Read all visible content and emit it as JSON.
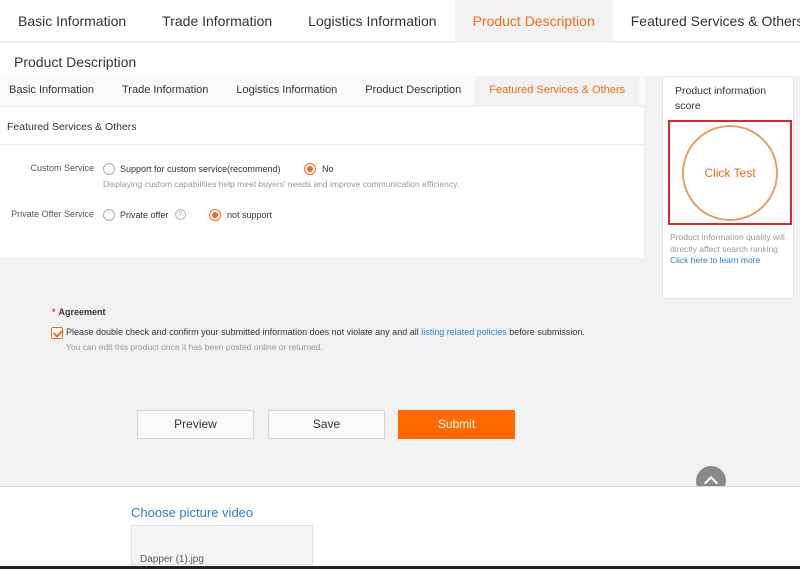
{
  "top_tabs": [
    {
      "label": "Basic Information"
    },
    {
      "label": "Trade Information"
    },
    {
      "label": "Logistics Information"
    },
    {
      "label": "Product Description"
    },
    {
      "label": "Featured Services & Others"
    }
  ],
  "page_title": "Product Description",
  "sub_tabs": [
    {
      "label": "Basic Information"
    },
    {
      "label": "Trade Information"
    },
    {
      "label": "Logistics Information"
    },
    {
      "label": "Product Description"
    },
    {
      "label": "Featured Services & Others"
    }
  ],
  "section_title": "Featured Services & Others",
  "custom_service": {
    "label": "Custom Service",
    "option_support": "Support for custom service(recommend)",
    "option_no": "No",
    "selected": "No",
    "hint": "Displaying custom capabilities help meet buyers' needs and improve communication efficiency."
  },
  "private_offer": {
    "label": "Private Offer Service",
    "option_private": "Private offer",
    "option_not_support": "not support",
    "selected": "not support"
  },
  "score_panel": {
    "title": "Product information score",
    "button": "Click Test",
    "note": "Product information quality will directly affect search ranking",
    "link": "Click here to learn more"
  },
  "agreement": {
    "label": "Agreement",
    "text_before": "Please double check and confirm your submitted information does not violate any and all",
    "link": "listing related policies",
    "text_after": "before submission.",
    "sub": "You can edit this product once it has been posted online or returned.",
    "checked": true
  },
  "buttons": {
    "preview": "Preview",
    "save": "Save",
    "submit": "Submit"
  },
  "media": {
    "title": "Choose picture video",
    "filename": "Dapper (1).jpg"
  },
  "colors": {
    "accent": "#f06a1d",
    "primary_button": "#ff6a00",
    "link": "#2a7fc1",
    "highlight_border": "#d7282f"
  }
}
